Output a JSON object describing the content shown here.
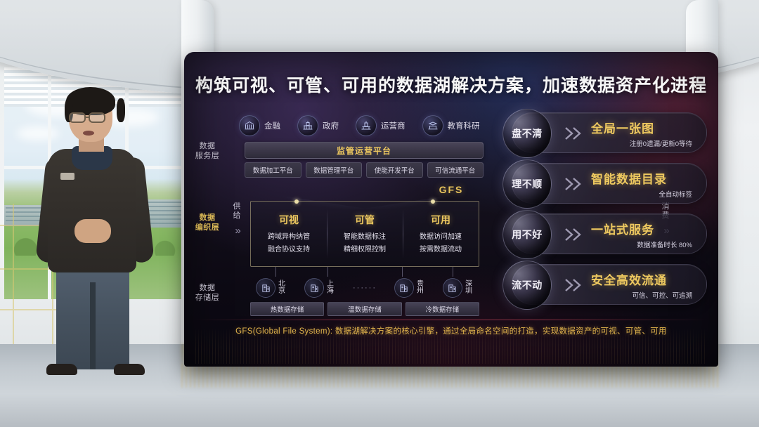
{
  "slide": {
    "title": "构筑可视、可管、可用的数据湖解决方案，加速数据资产化进程",
    "footer": "GFS(Global File System): 数据湖解决方案的核心引擎，通过全局命名空间的打造，实现数据资产的可视、可管、可用",
    "gfs_label": "GFS"
  },
  "layers": [
    {
      "line1": "数据",
      "line2": "服务层"
    },
    {
      "line1": "数据",
      "line2": "编织层"
    },
    {
      "line1": "数据",
      "line2": "存储层"
    }
  ],
  "industries": [
    {
      "label": "金融",
      "icon": "bank-icon"
    },
    {
      "label": "政府",
      "icon": "government-icon"
    },
    {
      "label": "运营商",
      "icon": "operator-icon"
    },
    {
      "label": "教育科研",
      "icon": "education-icon"
    }
  ],
  "service_layer": {
    "platform_bar": "监管运营平台",
    "platforms": [
      "数据加工平台",
      "数据管理平台",
      "使能开发平台",
      "可信流通平台"
    ]
  },
  "fabric_layer": {
    "left_side": {
      "line1": "供",
      "line2": "给",
      "arrow": "》"
    },
    "right_side": {
      "line1": "消",
      "line2": "费",
      "arrow": "》"
    },
    "columns": [
      {
        "heading": "可视",
        "line1": "跨域异构纳管",
        "line2": "融合协议支持"
      },
      {
        "heading": "可管",
        "line1": "智能数据标注",
        "line2": "精细权限控制"
      },
      {
        "heading": "可用",
        "line1": "数据访问加速",
        "line2": "按需数据流动"
      }
    ]
  },
  "storage_layer": {
    "cities": [
      {
        "label1": "北",
        "label2": "京",
        "icon": "building-icon"
      },
      {
        "label1": "上",
        "label2": "海",
        "icon": "building-icon"
      },
      {
        "label1": "贵",
        "label2": "州",
        "icon": "building-icon"
      },
      {
        "label1": "深",
        "label2": "圳",
        "icon": "building-icon"
      }
    ],
    "ellipsis": "······",
    "tiers": [
      "热数据存储",
      "温数据存储",
      "冷数据存储"
    ]
  },
  "outcomes": [
    {
      "problem": "盘不清",
      "solution": "全局一张图",
      "detail": "注册0遗漏/更新0等待"
    },
    {
      "problem": "理不顺",
      "solution": "智能数据目录",
      "detail": "全自动标签"
    },
    {
      "problem": "用不好",
      "solution": "一站式服务",
      "detail": "数据准备时长 80%"
    },
    {
      "problem": "流不动",
      "solution": "安全高效流通",
      "detail": "可信、可控、可追溯"
    }
  ],
  "colors": {
    "gold": "#edc85f",
    "screen_bg": "#15111d",
    "text": "#ffffff"
  }
}
